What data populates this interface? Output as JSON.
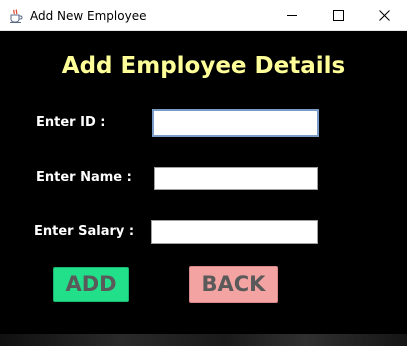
{
  "window": {
    "title": "Add New Employee",
    "controls": {
      "minimize": "minimize",
      "maximize": "maximize",
      "close": "close"
    }
  },
  "form": {
    "heading": "Add Employee Details",
    "id_label": "Enter ID :",
    "id_value": "",
    "name_label": "Enter Name :",
    "name_value": "",
    "salary_label": "Enter Salary :",
    "salary_value": ""
  },
  "buttons": {
    "add_label": "ADD",
    "back_label": "BACK"
  },
  "colors": {
    "background": "#000000",
    "heading": "#ffff99",
    "label": "#ffffff",
    "add_button": "#22e08a",
    "back_button": "#f4a3a3",
    "button_text": "#5a5a5a"
  },
  "icons": {
    "app": "java-cup-icon",
    "minimize": "minimize-icon",
    "maximize": "maximize-icon",
    "close": "close-icon"
  }
}
